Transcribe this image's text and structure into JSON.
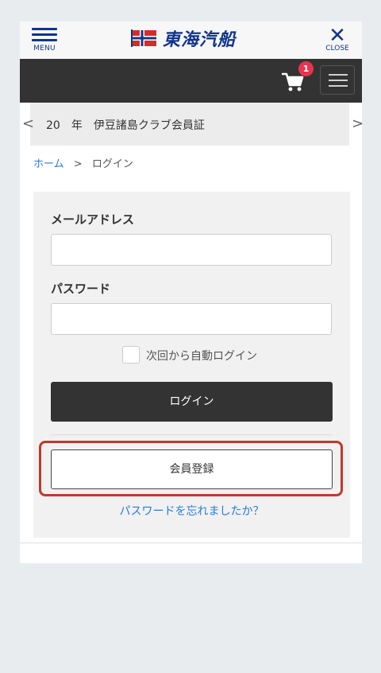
{
  "header": {
    "menu_label": "MENU",
    "logo_text": "東海汽船",
    "close_label": "CLOSE"
  },
  "cart": {
    "badge_count": "1"
  },
  "carousel": {
    "slide_text": "20　年　伊豆諸島クラブ会員証",
    "prev_glyph": "<",
    "next_glyph": ">"
  },
  "breadcrumb": {
    "home": "ホーム",
    "separator": ">",
    "current": "ログイン"
  },
  "form": {
    "email_label": "メールアドレス",
    "email_value": "",
    "password_label": "パスワード",
    "password_value": "",
    "remember_label": "次回から自動ログイン",
    "login_button": "ログイン",
    "register_button": "会員登録",
    "forgot_link": "パスワードを忘れましたか？"
  },
  "colors": {
    "brand": "#12348a",
    "link": "#2a7bd8",
    "highlight": "#c0392b",
    "badge": "#e8344e"
  }
}
